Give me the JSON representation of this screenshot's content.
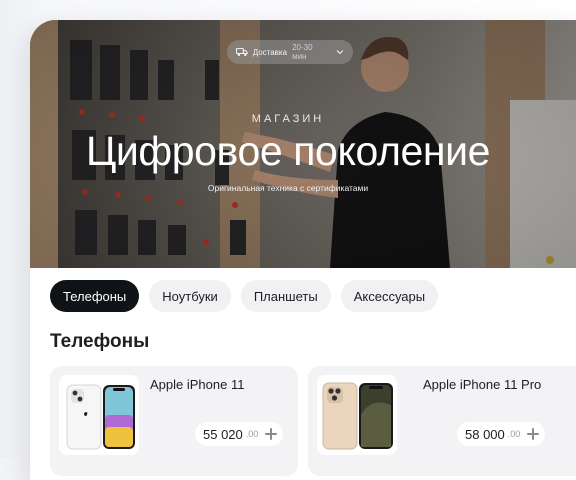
{
  "hero": {
    "delivery_label": "Доставка",
    "delivery_time": "20-30 мин",
    "kicker": "МАГАЗИН",
    "title": "Цифровое поколение",
    "subtitle": "Оригинальная техника с сертификатами"
  },
  "tabs": [
    {
      "label": "Телефоны",
      "active": true
    },
    {
      "label": "Ноутбуки",
      "active": false
    },
    {
      "label": "Планшеты",
      "active": false
    },
    {
      "label": "Аксессуары",
      "active": false
    }
  ],
  "section_title": "Телефоны",
  "products": [
    {
      "name": "Apple iPhone 11",
      "price_main": "55 020",
      "price_cents": ".00"
    },
    {
      "name": "Apple iPhone 11 Pro",
      "price_main": "58 000",
      "price_cents": ".00"
    }
  ],
  "colors": {
    "accent_dark": "#0f1318",
    "chip_bg": "#f1f1f3",
    "card_bg": "#f3f3f5"
  },
  "icons": [
    "truck-icon",
    "chevron-down-icon",
    "plus-icon"
  ]
}
